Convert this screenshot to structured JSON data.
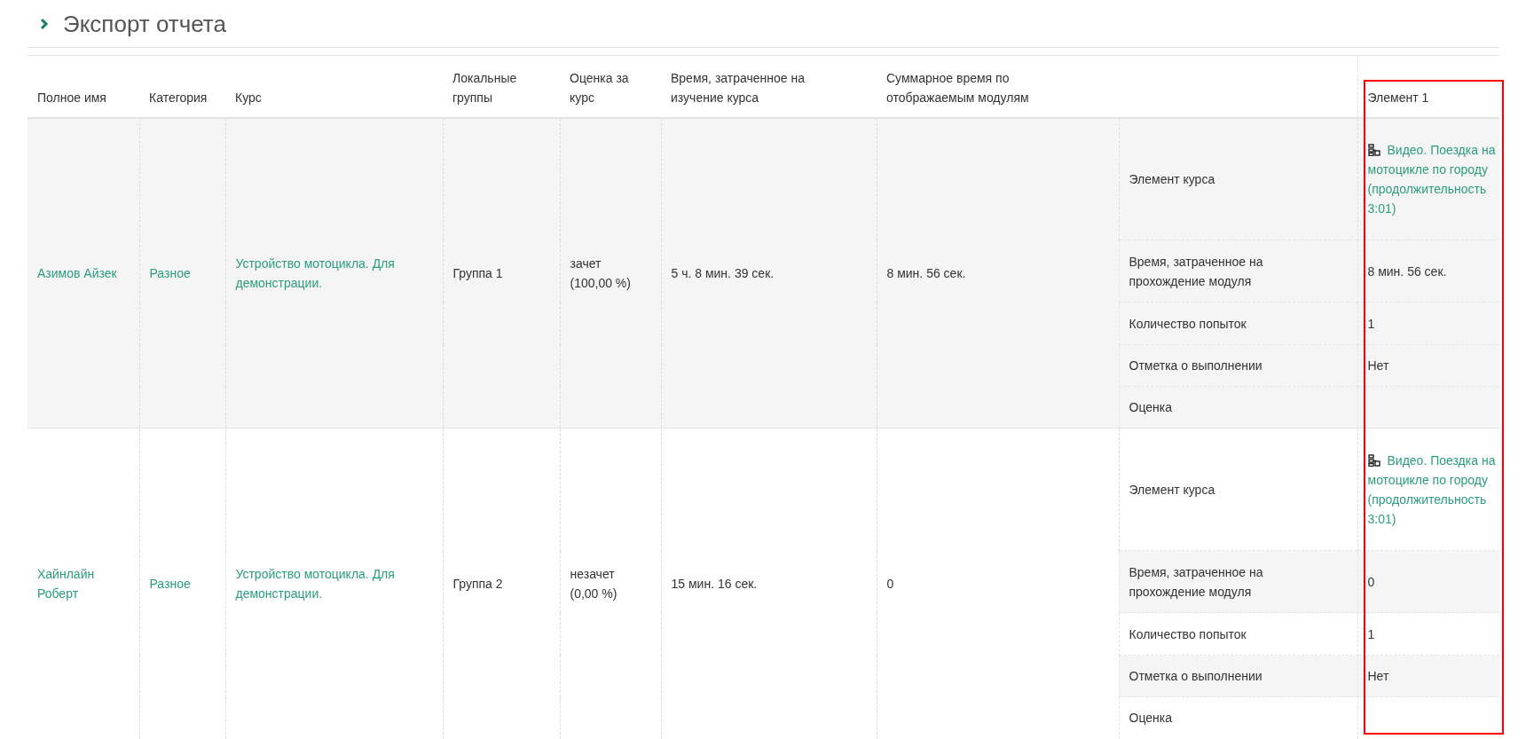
{
  "title": "Экспорт отчета",
  "table": {
    "columns": [
      "Полное имя",
      "Категория",
      "Курс",
      "Локальные группы",
      "Оценка за курс",
      "Время, затраченное на изучение курса",
      "Суммарное время по отображаемым модулям"
    ],
    "module_column": "Элемент 1",
    "rows": [
      {
        "name": "Азимов Айзек",
        "category": "Разное",
        "course": "Устройство мотоцикла. Для демонстрации.",
        "group": "Группа 1",
        "grade": "зачет (100,00 %)",
        "time_spent": "5 ч. 8 мин. 39 сек.",
        "module_time_total": "8 мин. 56 сек.",
        "details": [
          {
            "label": "Элемент курса",
            "kind": "link",
            "value": "Видео. Поездка на мотоцикле по городу (продолжительность 3:01)"
          },
          {
            "label": "Время, затраченное на прохождение модуля",
            "kind": "text",
            "value": "8 мин. 56 сек."
          },
          {
            "label": "Количество попыток",
            "kind": "text",
            "value": "1"
          },
          {
            "label": "Отметка о выполнении",
            "kind": "text",
            "value": "Нет"
          },
          {
            "label": "Оценка",
            "kind": "empty"
          }
        ]
      },
      {
        "name": "Хайнлайн Роберт",
        "category": "Разное",
        "course": "Устройство мотоцикла. Для демонстрации.",
        "group": "Группа 2",
        "grade": "незачет (0,00 %)",
        "time_spent": "15 мин. 16 сек.",
        "module_time_total": "0",
        "details": [
          {
            "label": "Элемент курса",
            "kind": "link",
            "value": "Видео. Поездка на мотоцикле по городу (продолжительность 3:01)"
          },
          {
            "label": "Время, затраченное на прохождение модуля",
            "kind": "text",
            "value": "0"
          },
          {
            "label": "Количество попыток",
            "kind": "text",
            "value": "1"
          },
          {
            "label": "Отметка о выполнении",
            "kind": "text",
            "value": "Нет"
          },
          {
            "label": "Оценка",
            "kind": "empty"
          }
        ]
      }
    ]
  }
}
